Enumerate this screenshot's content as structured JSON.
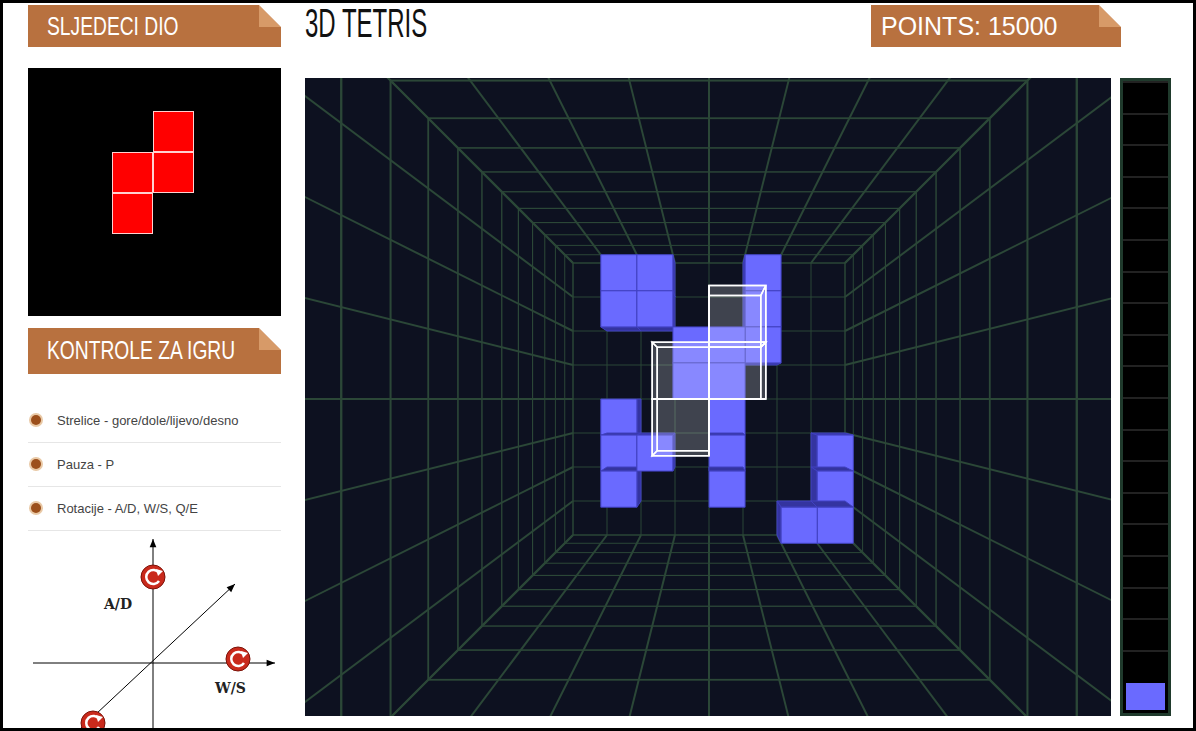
{
  "header": {
    "next_title": "SLJEDECI DIO",
    "game_title": "3D TETRIS",
    "points": "POINTS: 15000"
  },
  "next_piece": {
    "color": "#ff0000",
    "cells": [
      [
        1,
        0
      ],
      [
        0,
        1
      ],
      [
        1,
        1
      ],
      [
        0,
        2
      ]
    ]
  },
  "controls": {
    "title": "KONTROLE ZA IGRU",
    "items": [
      "Strelice - gore/dole/lijevo/desno",
      "Pauza - P",
      "Rotacije - A/D, W/S, Q/E"
    ],
    "axes": [
      "A/D",
      "W/S"
    ]
  },
  "board": {
    "landed_color": "#6a6aff",
    "landed": [
      [
        1,
        0
      ],
      [
        2,
        0
      ],
      [
        1,
        1
      ],
      [
        2,
        1
      ],
      [
        5,
        0
      ],
      [
        5,
        1
      ],
      [
        5,
        2
      ],
      [
        3,
        2
      ],
      [
        4,
        2
      ],
      [
        3,
        3
      ],
      [
        4,
        3
      ],
      [
        1,
        4
      ],
      [
        1,
        5
      ],
      [
        1,
        6
      ],
      [
        2,
        5
      ],
      [
        4,
        4
      ],
      [
        4,
        5
      ],
      [
        4,
        6
      ],
      [
        7,
        5
      ],
      [
        7,
        6
      ],
      [
        7,
        7
      ],
      [
        6,
        7
      ]
    ],
    "current": {
      "depth": 5,
      "cells": [
        [
          3,
          3
        ],
        [
          3,
          4
        ],
        [
          4,
          2
        ],
        [
          4,
          3
        ]
      ]
    }
  },
  "depth_meter": {
    "level": 0.05,
    "color": "#6a6aff"
  }
}
